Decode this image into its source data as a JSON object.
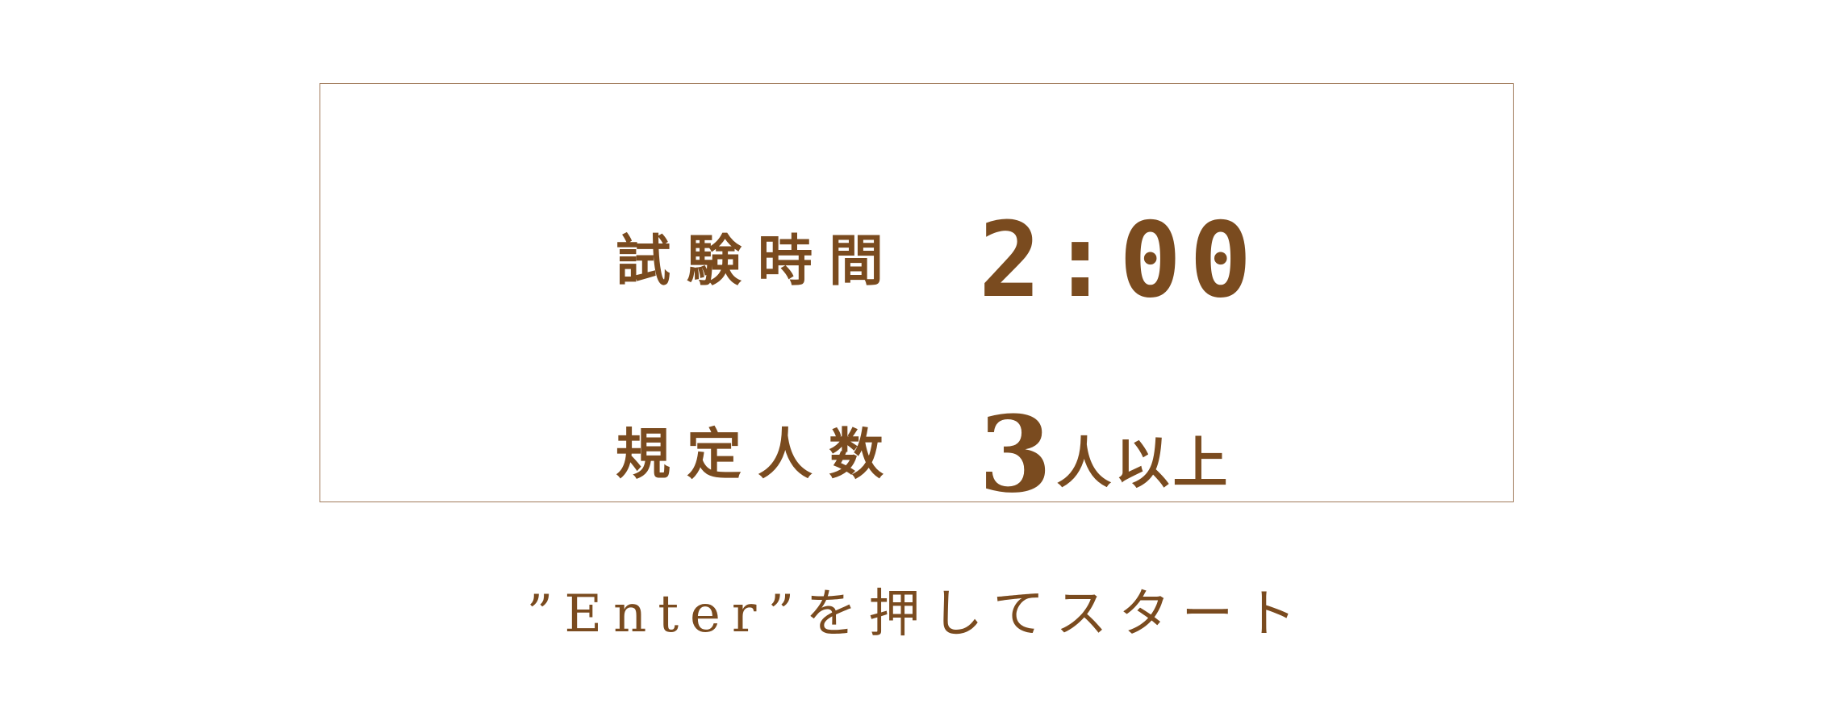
{
  "exam_info": {
    "time_label": "試験時間",
    "time_value": "2:00",
    "people_label": "規定人数",
    "people_number": "3",
    "people_suffix": "人以上"
  },
  "start_prompt": "”Enter”を押してスタート",
  "colors": {
    "text": "#7a4b1f",
    "card_border": "#a07a5a",
    "background": "#ffffff"
  }
}
